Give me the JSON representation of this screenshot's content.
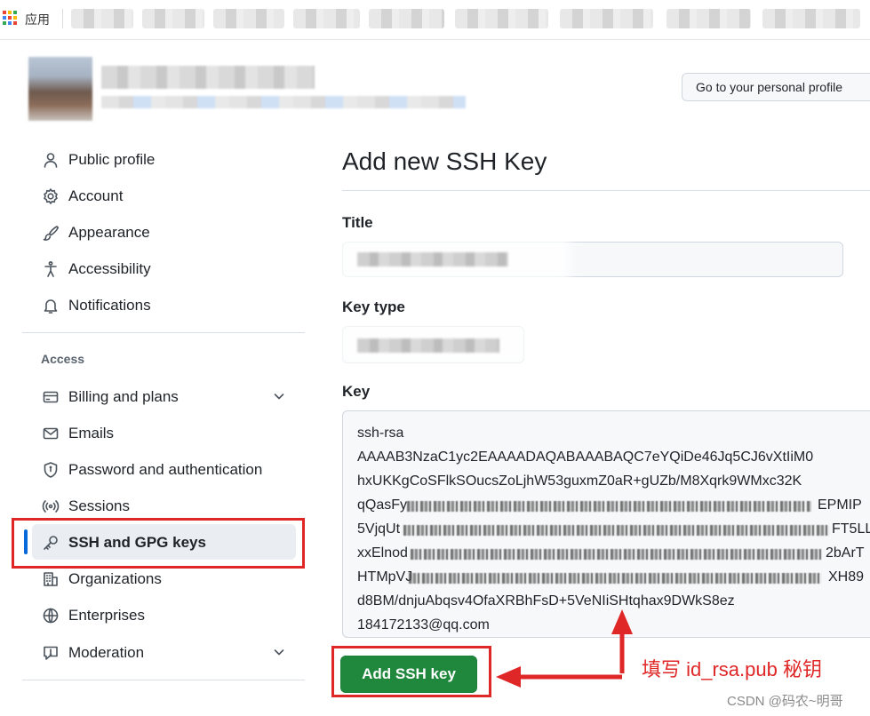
{
  "browser": {
    "apps_label": "应用"
  },
  "header": {
    "profile_button": "Go to your personal profile"
  },
  "sidebar": {
    "items": [
      {
        "label": "Public profile"
      },
      {
        "label": "Account"
      },
      {
        "label": "Appearance"
      },
      {
        "label": "Accessibility"
      },
      {
        "label": "Notifications"
      }
    ],
    "section_access": "Access",
    "access_items": [
      {
        "label": "Billing and plans"
      },
      {
        "label": "Emails"
      },
      {
        "label": "Password and authentication"
      },
      {
        "label": "Sessions"
      },
      {
        "label": "SSH and GPG keys"
      },
      {
        "label": "Organizations"
      },
      {
        "label": "Enterprises"
      },
      {
        "label": "Moderation"
      }
    ],
    "active_item": "SSH and GPG keys"
  },
  "main": {
    "title": "Add new SSH Key",
    "title_label": "Title",
    "key_type_label": "Key type",
    "key_label": "Key",
    "key_lines": [
      "ssh-rsa",
      "AAAAB3NzaC1yc2EAAAADAQABAAABAQC7eYQiDe46Jq5CJ6vXtIiM0",
      "hxUKKgCoSFlkSOucsZoLjhW53guxmZ0aR+gUZb/M8Xqrk9WMxc32K",
      "qQasFy",
      "5VjqUt",
      "xxElnod",
      "HTMpVJ",
      "d8BM/dnjuAbqsv4OfaXRBhFsD+5VeNIiSHtqhax9DWkS8ez",
      "184172133@qq.com"
    ],
    "key_line_tails": {
      "line4": "EPMIP",
      "line5": "FT5LL",
      "line6": "2bArT",
      "line7": "XH89"
    },
    "submit_button": "Add SSH key"
  },
  "annotation": {
    "text": "填写 id_rsa.pub 秘钥",
    "color": "#e02727"
  },
  "watermark": "CSDN @码农~明哥",
  "colors": {
    "accent": "#0969da",
    "primary_button": "#1f883d",
    "annotation_red": "#e02727"
  }
}
